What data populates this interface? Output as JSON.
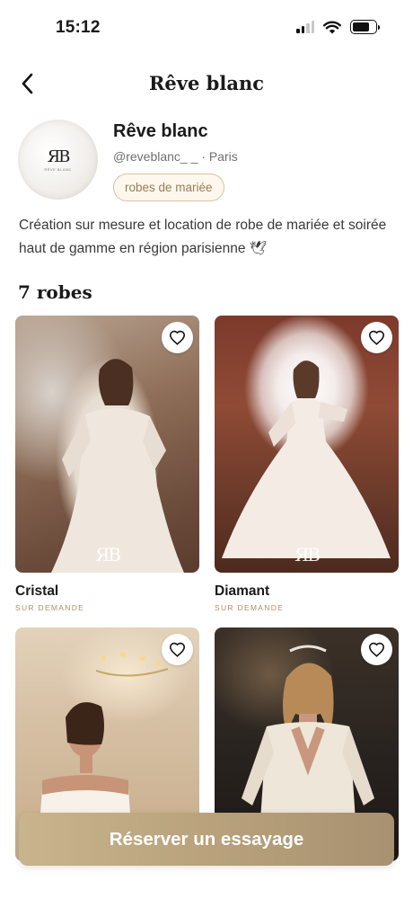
{
  "status_bar": {
    "time": "15:12"
  },
  "nav": {
    "title": "Rêve blanc"
  },
  "profile": {
    "name": "Rêve blanc",
    "handle": "@reveblanc_ _ · Paris",
    "category": "robes de mariée",
    "avatar_logo": "ЯB",
    "avatar_sub": "RÊVE BLANC"
  },
  "description": "Création sur mesure et location de robe de mariée et soirée haut de gamme en région parisienne 🕊",
  "section": {
    "title": "7 robes"
  },
  "dresses": [
    {
      "name": "Cristal",
      "availability": "SUR DEMANDE",
      "logo": "ЯB"
    },
    {
      "name": "Diamant",
      "availability": "SUR DEMANDE",
      "logo": "ЯB"
    },
    {
      "name": "",
      "availability": ""
    },
    {
      "name": "",
      "availability": ""
    }
  ],
  "cta": {
    "label": "Réserver un essayage"
  },
  "colors": {
    "accent": "#b7a07a",
    "tag_border": "#d9c3a4",
    "tag_text": "#9a7d57",
    "availability": "#b08e62"
  },
  "icons": {
    "back": "chevron-left-icon",
    "favorite": "heart-outline-icon",
    "signal": "cellular-signal-icon",
    "wifi": "wifi-icon",
    "battery": "battery-icon"
  }
}
